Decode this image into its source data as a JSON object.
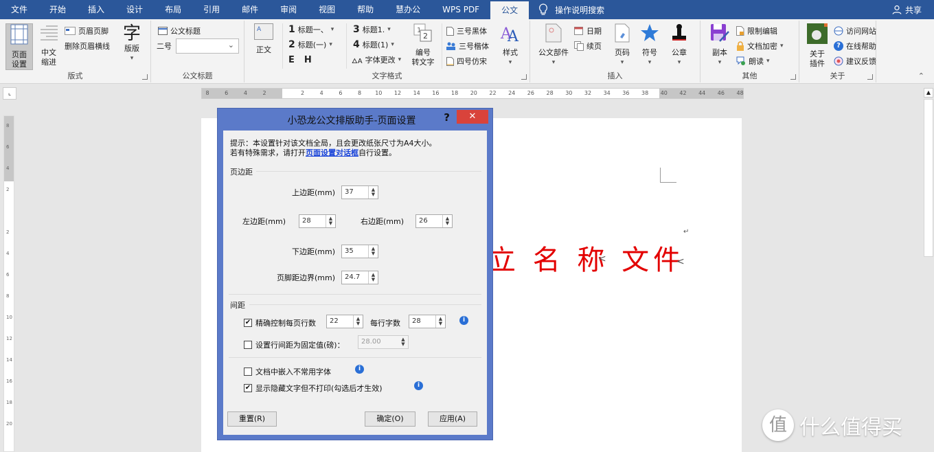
{
  "menubar": {
    "tabs": [
      "文件",
      "开始",
      "插入",
      "设计",
      "布局",
      "引用",
      "邮件",
      "审阅",
      "视图",
      "帮助",
      "慧办公",
      "WPS PDF",
      "公文"
    ],
    "active_tab": "公文",
    "search_label": "操作说明搜索",
    "share_label": "共享"
  },
  "ribbon": {
    "groups": {
      "layout": {
        "label": "版式",
        "page_setup": "页面设置",
        "page_setup_l1": "页面",
        "page_setup_l2": "设置",
        "cn_indent_l1": "中文",
        "cn_indent_l2": "缩进",
        "header_footer": "页眉页脚",
        "remove_header_line": "删除页眉横线",
        "font_layout": "版版",
        "font_icon": "字"
      },
      "doc_title": {
        "label": "公文标题",
        "title_btn": "公文标题",
        "size_label": "二号",
        "size_value": ""
      },
      "text_style": {
        "label": "文字格式",
        "body_text": "正文",
        "h1": "标题一、",
        "h2": "标题(一)",
        "h3": "标题1.",
        "h4": "标题(1)",
        "font_change": "字体更改",
        "number1": "1",
        "number2": "2",
        "number3": "3",
        "number4": "4",
        "e_label": "E",
        "h_label": "H",
        "numbering_l1": "编号",
        "numbering_l2": "转文字",
        "font_a": "三号黑体",
        "font_b": "三号楷体",
        "font_c": "四号仿宋",
        "styles": "样式"
      },
      "insert": {
        "label": "插入",
        "doc_component": "公文部件",
        "date": "日期",
        "continuation": "续页",
        "page_number": "页码",
        "symbol": "符号",
        "seal": "公章"
      },
      "other": {
        "label": "其他",
        "copy": "副本",
        "restrict_edit": "限制编辑",
        "encrypt": "文档加密",
        "read": "朗读"
      },
      "about": {
        "label": "关于",
        "plugin_l1": "关于",
        "plugin_l2": "插件",
        "website": "访问网站",
        "online_help": "在线帮助",
        "feedback": "建议反馈"
      }
    }
  },
  "ruler": {
    "ticks": [
      "8",
      "6",
      "4",
      "2",
      "",
      "2",
      "4",
      "6",
      "8",
      "10",
      "12",
      "14",
      "16",
      "18",
      "20",
      "22",
      "24",
      "26",
      "28",
      "30",
      "32",
      "34",
      "36",
      "38",
      "40",
      "42",
      "44",
      "46",
      "48"
    ],
    "vticks": [
      "8",
      "6",
      "4",
      "2",
      "",
      "2",
      "4",
      "6",
      "8",
      "10",
      "12",
      "14",
      "16",
      "18",
      "20"
    ]
  },
  "document": {
    "title_text": "位名称文件",
    "visible_title": "立 名 称 文件"
  },
  "dialog": {
    "title": "小恐龙公文排版助手-页面设置",
    "help": "?",
    "close": "✕",
    "hint_line1": "提示：本设置针对该文档全局，且会更改纸张尺寸为A4大小。",
    "hint_line2a": "若有特殊需求，请打开",
    "hint_link": "页面设置对话框",
    "hint_line2b": "自行设置。",
    "margins_section": "页边距",
    "top_label": "上边距(mm)",
    "top_value": "37",
    "left_label": "左边距(mm)",
    "left_value": "28",
    "right_label": "右边距(mm)",
    "right_value": "26",
    "bottom_label": "下边距(mm)",
    "bottom_value": "35",
    "footer_label": "页脚距边界(mm)",
    "footer_value": "24.7",
    "spacing_section": "间距",
    "precise_label": "精确控制每页行数",
    "precise_checked": true,
    "lines_value": "22",
    "chars_label": "每行字数",
    "chars_value": "28",
    "fixed_label": "设置行间距为固定值(磅)：",
    "fixed_checked": false,
    "fixed_value": "28.00",
    "embed_label": "文档中嵌入不常用字体",
    "embed_checked": false,
    "hidden_label": "显示隐藏文字但不打印(勾选后才生效)",
    "hidden_checked": true,
    "reset_btn": "重置(R)",
    "ok_btn": "确定(O)",
    "apply_btn": "应用(A)"
  },
  "watermark": {
    "badge": "值",
    "text": "什么值得买"
  },
  "colors": {
    "menubar": "#2b579a",
    "dialog_frame": "#5b7ac9",
    "close_button": "#d9433b",
    "doc_title": "#e30000",
    "link": "#1a44d9",
    "info": "#2a6fd6"
  }
}
